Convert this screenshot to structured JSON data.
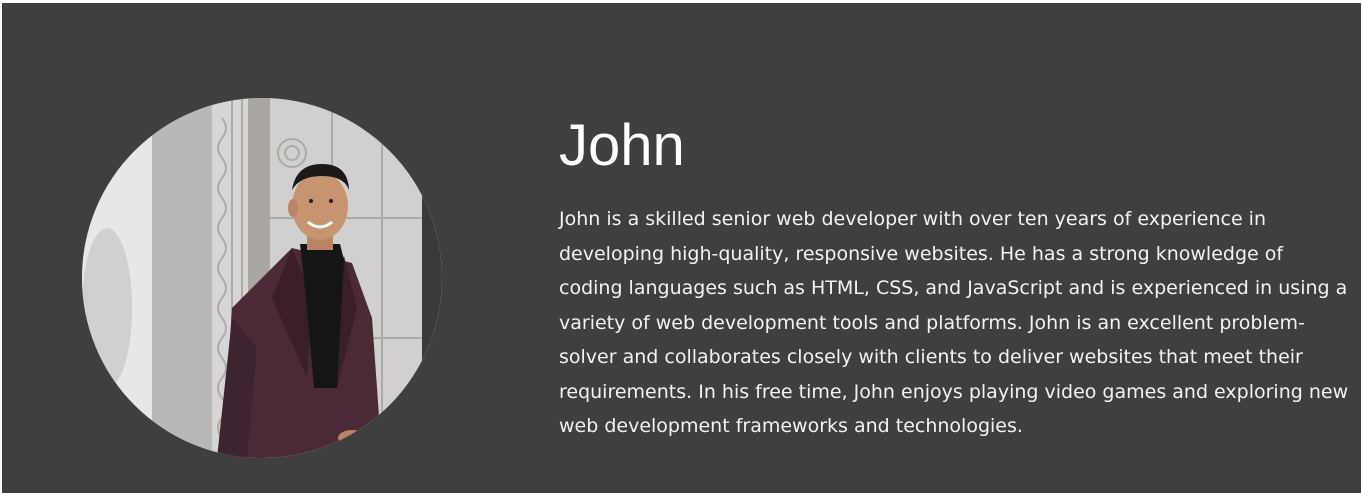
{
  "profile": {
    "name": "John",
    "bio": "John is a skilled senior web developer with over ten years of experience in developing high-quality, responsive websites. He has a strong knowledge of coding languages such as HTML, CSS, and JavaScript and is experienced in using a variety of web development tools and platforms. John is an excellent problem-solver and collaborates closely with clients to deliver websites that meet their requirements. In his free time, John enjoys playing video games and exploring new web development frameworks and technologies.",
    "photo": "circular portrait of a smiling man in a burgundy blazer and black turtleneck in front of a stone wall"
  },
  "colors": {
    "background": "#3f3f3f",
    "text": "#ffffff",
    "blazer": "#4a2a36"
  }
}
